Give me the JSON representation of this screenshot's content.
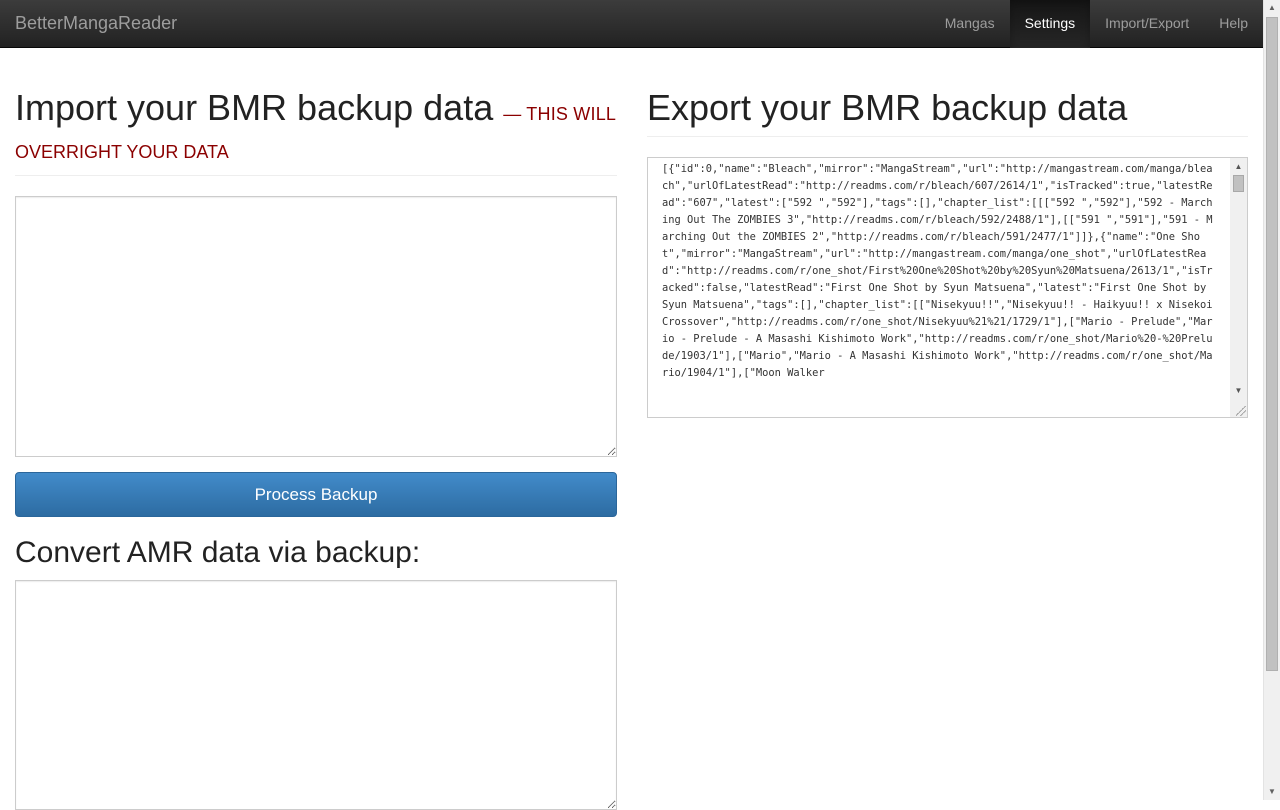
{
  "navbar": {
    "brand": "BetterMangaReader",
    "items": [
      {
        "label": "Mangas",
        "active": false
      },
      {
        "label": "Settings",
        "active": true
      },
      {
        "label": "Import/Export",
        "active": false
      },
      {
        "label": "Help",
        "active": false
      }
    ]
  },
  "import": {
    "title": "Import your BMR backup data",
    "warning_line1": "— THIS WILL",
    "warning_line2": "OVERRIGHT YOUR DATA",
    "textarea_value": "",
    "button_label": "Process Backup"
  },
  "convert": {
    "title": "Convert AMR data via backup:",
    "textarea_value": ""
  },
  "export": {
    "title": "Export your BMR backup data",
    "data": "[{\"id\":0,\"name\":\"Bleach\",\"mirror\":\"MangaStream\",\"url\":\"http://mangastream.com/manga/bleach\",\"urlOfLatestRead\":\"http://readms.com/r/bleach/607/2614/1\",\"isTracked\":true,\"latestRead\":\"607\",\"latest\":[\"592 \",\"592\"],\"tags\":[],\"chapter_list\":[[[\"592 \",\"592\"],\"592 - Marching Out The ZOMBIES 3\",\"http://readms.com/r/bleach/592/2488/1\"],[[\"591 \",\"591\"],\"591 - Marching Out the ZOMBIES 2\",\"http://readms.com/r/bleach/591/2477/1\"]]},{\"name\":\"One Shot\",\"mirror\":\"MangaStream\",\"url\":\"http://mangastream.com/manga/one_shot\",\"urlOfLatestRead\":\"http://readms.com/r/one_shot/First%20One%20Shot%20by%20Syun%20Matsuena/2613/1\",\"isTracked\":false,\"latestRead\":\"First One Shot by Syun Matsuena\",\"latest\":\"First One Shot by Syun Matsuena\",\"tags\":[],\"chapter_list\":[[\"Nisekyuu!!\",\"Nisekyuu!! - Haikyuu!! x Nisekoi Crossover\",\"http://readms.com/r/one_shot/Nisekyuu%21%21/1729/1\"],[\"Mario - Prelude\",\"Mario - Prelude - A Masashi Kishimoto Work\",\"http://readms.com/r/one_shot/Mario%20-%20Prelude/1903/1\"],[\"Mario\",\"Mario - A Masashi Kishimoto Work\",\"http://readms.com/r/one_shot/Mario/1904/1\"],[\"Moon Walker"
  },
  "icons": {
    "scroll_up": "▲",
    "scroll_down": "▼"
  }
}
